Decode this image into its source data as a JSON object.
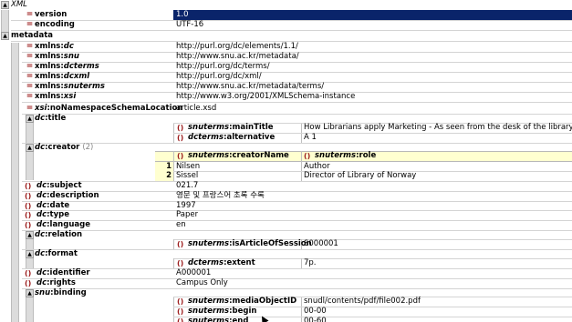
{
  "root": {
    "label": "XML"
  },
  "declaration": [
    {
      "name": "version",
      "value": "1.0"
    },
    {
      "name": "encoding",
      "value": "UTF-16"
    }
  ],
  "metadata": {
    "label": "metadata",
    "xmlns": [
      {
        "prefix": "dc",
        "value": "http://purl.org/dc/elements/1.1/"
      },
      {
        "prefix": "snu",
        "value": "http://www.snu.ac.kr/metadata/"
      },
      {
        "prefix": "dcterms",
        "value": "http://purl.org/dc/terms/"
      },
      {
        "prefix": "dcxml",
        "value": "http://purl.org/dc/xml/"
      },
      {
        "prefix": "snuterms",
        "value": "http://www.snu.ac.kr/metadata/terms/"
      },
      {
        "prefix": "xsi",
        "value": "http://www.w3.org/2001/XMLSchema-instance"
      }
    ],
    "xmlns_label": "xmlns",
    "noNs": {
      "prefix": "xsi",
      "name": "noNamespaceSchemaLocation",
      "value": "article.xsd"
    },
    "title": {
      "prefix": "dc",
      "name": "title",
      "children": [
        {
          "prefix": "snuterms",
          "name": "mainTitle",
          "value": "How Librarians apply Marketing - As seen from the desk of the library manag"
        },
        {
          "prefix": "dcterms",
          "name": "alternative",
          "value": "A 1"
        }
      ]
    },
    "creator": {
      "prefix": "dc",
      "name": "creator",
      "count": "(2)",
      "columns": [
        {
          "prefix": "snuterms",
          "name": "creatorName"
        },
        {
          "prefix": "snuterms",
          "name": "role"
        }
      ],
      "rows": [
        {
          "num": "1",
          "name": "Nilsen",
          "role": "Author"
        },
        {
          "num": "2",
          "name": "Sissel",
          "role": "Director of Library of Norway"
        }
      ]
    },
    "simple1": [
      {
        "prefix": "dc",
        "name": "subject",
        "value": "021.7"
      },
      {
        "prefix": "dc",
        "name": "description",
        "value": "영문 및 프랑스어 초록 수록"
      },
      {
        "prefix": "dc",
        "name": "date",
        "value": "1997"
      },
      {
        "prefix": "dc",
        "name": "type",
        "value": "Paper"
      },
      {
        "prefix": "dc",
        "name": "language",
        "value": "en"
      }
    ],
    "relation": {
      "prefix": "dc",
      "name": "relation",
      "child": {
        "prefix": "snuterms",
        "name": "isArticleOfSession",
        "value": "S000001"
      }
    },
    "format": {
      "prefix": "dc",
      "name": "format",
      "child": {
        "prefix": "dcterms",
        "name": "extent",
        "value": "7p."
      }
    },
    "simple2": [
      {
        "prefix": "dc",
        "name": "identifier",
        "value": "A000001"
      },
      {
        "prefix": "dc",
        "name": "rights",
        "value": "Campus Only"
      }
    ],
    "binding": {
      "prefix": "snu",
      "name": "binding",
      "children": [
        {
          "prefix": "snuterms",
          "name": "mediaObjectID",
          "value": "snudl/contents/pdf/file002.pdf"
        },
        {
          "prefix": "snuterms",
          "name": "begin",
          "value": "00-00"
        },
        {
          "prefix": "snuterms",
          "name": "end",
          "value": "00-60"
        }
      ]
    }
  },
  "glyphs": {
    "collapse": "▲",
    "attr": "=",
    "element": "()"
  },
  "colors": {
    "selection": "#0a246a",
    "element_marker": "#9b1a1a",
    "table_header": "#ffffd0"
  }
}
